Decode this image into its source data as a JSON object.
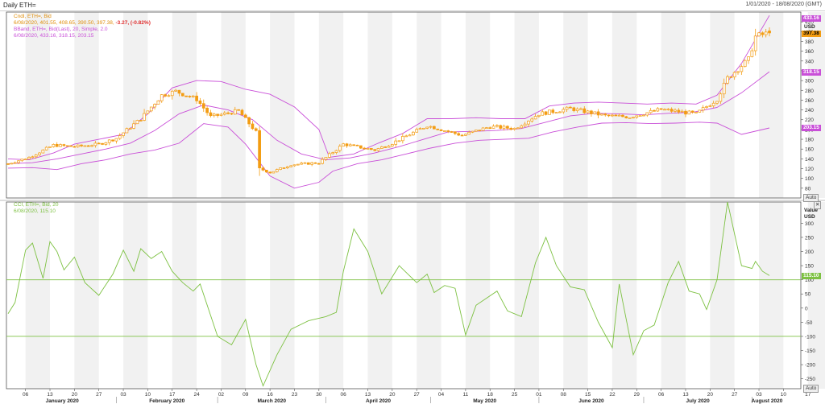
{
  "window": {
    "title": "Daily ETH=",
    "range": "1/01/2020 - 18/08/2020 (GMT)"
  },
  "legend_price": {
    "l1": "Cndl, ETH=, Bid",
    "l2a": "6/08/2020, 401.55, 408.65, 390.50, 397.38,",
    "l2b": " -3.27, (-0.82%)",
    "l3": "BBand, ETH=, Bid(Last), 20, Simple, 2.0",
    "l4": "6/08/2020, 433.16, 318.15, 203.15"
  },
  "legend_cci": {
    "l1": "CCI, ETH=, Bid, 20",
    "l2": "6/08/2020, 115.10"
  },
  "axis_price": {
    "unit1": "Price",
    "unit2": "USD",
    "button": "Auto",
    "ticks": [
      "80",
      "100",
      "120",
      "140",
      "160",
      "180",
      "200",
      "220",
      "240",
      "260",
      "280",
      "300",
      "320",
      "340",
      "360",
      "380",
      "400",
      "420"
    ]
  },
  "axis_cci": {
    "unit1": "Value",
    "unit2": "USD",
    "button": "Auto",
    "ticks": [
      "-250",
      "-200",
      "-150",
      "-100",
      "-50",
      "0",
      "50",
      "100",
      "150",
      "200",
      "250",
      "300"
    ]
  },
  "tags": {
    "upper": "433.16",
    "close": "397.38",
    "mid": "318.15",
    "lower": "203.15",
    "cci": "115.10"
  },
  "colors": {
    "candle": "#f39c12",
    "band": "#c94fd8",
    "cci": "#7dc142",
    "tag_close": "#f39c12",
    "tag_band": "#c94fd8",
    "tag_cci": "#7dc142"
  },
  "xaxis": {
    "days": [
      "06",
      "13",
      "20",
      "27",
      "03",
      "10",
      "17",
      "24",
      "02",
      "09",
      "16",
      "23",
      "30",
      "06",
      "13",
      "20",
      "27",
      "04",
      "11",
      "18",
      "25",
      "01",
      "08",
      "15",
      "22",
      "29",
      "06",
      "13",
      "20",
      "27",
      "03",
      "10",
      "17"
    ],
    "months": [
      "January 2020",
      "February 2020",
      "March 2020",
      "April 2020",
      "May 2020",
      "June 2020",
      "July 2020",
      "August 2020"
    ]
  },
  "chart_data": [
    {
      "type": "candlestick",
      "title": "Daily ETH=",
      "unit": "USD",
      "ylim": [
        60,
        440
      ],
      "x_start": "2020-01-01",
      "x_end": "2020-08-06",
      "close_anchors": [
        {
          "date": "2020-01-01",
          "value": 130
        },
        {
          "date": "2020-01-07",
          "value": 143
        },
        {
          "date": "2020-01-14",
          "value": 168
        },
        {
          "date": "2020-01-20",
          "value": 165
        },
        {
          "date": "2020-01-27",
          "value": 170
        },
        {
          "date": "2020-02-01",
          "value": 182
        },
        {
          "date": "2020-02-08",
          "value": 222
        },
        {
          "date": "2020-02-14",
          "value": 270
        },
        {
          "date": "2020-02-18",
          "value": 278
        },
        {
          "date": "2020-02-24",
          "value": 262
        },
        {
          "date": "2020-02-28",
          "value": 226
        },
        {
          "date": "2020-03-07",
          "value": 238
        },
        {
          "date": "2020-03-12",
          "value": 195
        },
        {
          "date": "2020-03-13",
          "value": 120
        },
        {
          "date": "2020-03-16",
          "value": 112
        },
        {
          "date": "2020-03-22",
          "value": 128
        },
        {
          "date": "2020-03-30",
          "value": 132
        },
        {
          "date": "2020-04-06",
          "value": 170
        },
        {
          "date": "2020-04-15",
          "value": 158
        },
        {
          "date": "2020-04-20",
          "value": 172
        },
        {
          "date": "2020-04-30",
          "value": 208
        },
        {
          "date": "2020-05-10",
          "value": 188
        },
        {
          "date": "2020-05-18",
          "value": 206
        },
        {
          "date": "2020-05-25",
          "value": 202
        },
        {
          "date": "2020-06-01",
          "value": 232
        },
        {
          "date": "2020-06-10",
          "value": 243
        },
        {
          "date": "2020-06-20",
          "value": 228
        },
        {
          "date": "2020-06-27",
          "value": 226
        },
        {
          "date": "2020-07-06",
          "value": 241
        },
        {
          "date": "2020-07-16",
          "value": 232
        },
        {
          "date": "2020-07-22",
          "value": 262
        },
        {
          "date": "2020-07-25",
          "value": 305
        },
        {
          "date": "2020-07-31",
          "value": 343
        },
        {
          "date": "2020-08-02",
          "value": 390
        },
        {
          "date": "2020-08-06",
          "value": 397.38
        }
      ],
      "last_bar": {
        "date": "2020-08-06",
        "open": 401.55,
        "high": 408.65,
        "low": 390.5,
        "close": 397.38,
        "change": -3.27,
        "change_pct": -0.82
      }
    },
    {
      "type": "line",
      "series": [
        {
          "name": "BBand upper",
          "points": [
            [
              "2020-01-01",
              140
            ],
            [
              "2020-01-07",
              138
            ],
            [
              "2020-01-14",
              152
            ],
            [
              "2020-01-20",
              170
            ],
            [
              "2020-01-27",
              180
            ],
            [
              "2020-02-03",
              190
            ],
            [
              "2020-02-10",
              232
            ],
            [
              "2020-02-17",
              285
            ],
            [
              "2020-02-24",
              300
            ],
            [
              "2020-03-02",
              298
            ],
            [
              "2020-03-09",
              282
            ],
            [
              "2020-03-16",
              272
            ],
            [
              "2020-03-23",
              246
            ],
            [
              "2020-03-30",
              200
            ],
            [
              "2020-04-02",
              143
            ],
            [
              "2020-04-09",
              150
            ],
            [
              "2020-04-16",
              172
            ],
            [
              "2020-04-23",
              192
            ],
            [
              "2020-04-30",
              222
            ],
            [
              "2020-05-07",
              222
            ],
            [
              "2020-05-14",
              224
            ],
            [
              "2020-05-21",
              222
            ],
            [
              "2020-05-28",
              222
            ],
            [
              "2020-06-04",
              248
            ],
            [
              "2020-06-11",
              254
            ],
            [
              "2020-06-18",
              256
            ],
            [
              "2020-06-25",
              254
            ],
            [
              "2020-07-02",
              252
            ],
            [
              "2020-07-09",
              254
            ],
            [
              "2020-07-16",
              252
            ],
            [
              "2020-07-22",
              270
            ],
            [
              "2020-07-29",
              335
            ],
            [
              "2020-08-06",
              433.16
            ]
          ]
        },
        {
          "name": "BBand middle",
          "points": [
            [
              "2020-01-01",
              130
            ],
            [
              "2020-01-08",
              132
            ],
            [
              "2020-01-15",
              140
            ],
            [
              "2020-01-22",
              150
            ],
            [
              "2020-01-29",
              160
            ],
            [
              "2020-02-05",
              172
            ],
            [
              "2020-02-12",
              198
            ],
            [
              "2020-02-19",
              232
            ],
            [
              "2020-02-26",
              250
            ],
            [
              "2020-03-04",
              240
            ],
            [
              "2020-03-11",
              220
            ],
            [
              "2020-03-18",
              178
            ],
            [
              "2020-03-25",
              150
            ],
            [
              "2020-04-01",
              138
            ],
            [
              "2020-04-08",
              142
            ],
            [
              "2020-04-15",
              152
            ],
            [
              "2020-04-22",
              165
            ],
            [
              "2020-04-29",
              180
            ],
            [
              "2020-05-06",
              195
            ],
            [
              "2020-05-13",
              196
            ],
            [
              "2020-05-20",
              198
            ],
            [
              "2020-05-27",
              202
            ],
            [
              "2020-06-03",
              215
            ],
            [
              "2020-06-10",
              228
            ],
            [
              "2020-06-17",
              233
            ],
            [
              "2020-06-24",
              232
            ],
            [
              "2020-07-01",
              230
            ],
            [
              "2020-07-08",
              233
            ],
            [
              "2020-07-15",
              235
            ],
            [
              "2020-07-22",
              245
            ],
            [
              "2020-07-29",
              275
            ],
            [
              "2020-08-06",
              318.15
            ]
          ]
        },
        {
          "name": "BBand lower",
          "points": [
            [
              "2020-01-01",
              121
            ],
            [
              "2020-01-08",
              122
            ],
            [
              "2020-01-15",
              118
            ],
            [
              "2020-01-22",
              130
            ],
            [
              "2020-01-29",
              138
            ],
            [
              "2020-02-05",
              150
            ],
            [
              "2020-02-12",
              158
            ],
            [
              "2020-02-19",
              172
            ],
            [
              "2020-02-26",
              212
            ],
            [
              "2020-03-04",
              205
            ],
            [
              "2020-03-09",
              170
            ],
            [
              "2020-03-16",
              105
            ],
            [
              "2020-03-23",
              80
            ],
            [
              "2020-03-30",
              92
            ],
            [
              "2020-04-03",
              115
            ],
            [
              "2020-04-10",
              130
            ],
            [
              "2020-04-17",
              138
            ],
            [
              "2020-04-24",
              150
            ],
            [
              "2020-05-01",
              162
            ],
            [
              "2020-05-08",
              172
            ],
            [
              "2020-05-15",
              178
            ],
            [
              "2020-05-22",
              180
            ],
            [
              "2020-05-29",
              182
            ],
            [
              "2020-06-05",
              195
            ],
            [
              "2020-06-12",
              205
            ],
            [
              "2020-06-19",
              213
            ],
            [
              "2020-06-26",
              214
            ],
            [
              "2020-07-03",
              212
            ],
            [
              "2020-07-10",
              213
            ],
            [
              "2020-07-17",
              215
            ],
            [
              "2020-07-22",
              213
            ],
            [
              "2020-07-29",
              190
            ],
            [
              "2020-08-06",
              203.15
            ]
          ]
        }
      ]
    },
    {
      "type": "line",
      "unit": "USD",
      "ylim": [
        -285,
        375
      ],
      "hlines": [
        100,
        -100
      ],
      "series": [
        {
          "name": "CCI",
          "points": [
            [
              "2020-01-01",
              -20
            ],
            [
              "2020-01-03",
              20
            ],
            [
              "2020-01-06",
              205
            ],
            [
              "2020-01-08",
              230
            ],
            [
              "2020-01-11",
              105
            ],
            [
              "2020-01-13",
              235
            ],
            [
              "2020-01-15",
              200
            ],
            [
              "2020-01-17",
              135
            ],
            [
              "2020-01-20",
              180
            ],
            [
              "2020-01-23",
              90
            ],
            [
              "2020-01-27",
              45
            ],
            [
              "2020-01-31",
              120
            ],
            [
              "2020-02-03",
              205
            ],
            [
              "2020-02-06",
              130
            ],
            [
              "2020-02-08",
              210
            ],
            [
              "2020-02-11",
              175
            ],
            [
              "2020-02-14",
              200
            ],
            [
              "2020-02-17",
              130
            ],
            [
              "2020-02-20",
              90
            ],
            [
              "2020-02-23",
              60
            ],
            [
              "2020-02-25",
              85
            ],
            [
              "2020-03-01",
              -100
            ],
            [
              "2020-03-05",
              -130
            ],
            [
              "2020-03-09",
              -40
            ],
            [
              "2020-03-12",
              -200
            ],
            [
              "2020-03-14",
              -275
            ],
            [
              "2020-03-18",
              -165
            ],
            [
              "2020-03-22",
              -75
            ],
            [
              "2020-03-27",
              -45
            ],
            [
              "2020-04-01",
              -30
            ],
            [
              "2020-04-04",
              -15
            ],
            [
              "2020-04-06",
              130
            ],
            [
              "2020-04-09",
              280
            ],
            [
              "2020-04-13",
              200
            ],
            [
              "2020-04-17",
              50
            ],
            [
              "2020-04-22",
              150
            ],
            [
              "2020-04-27",
              90
            ],
            [
              "2020-04-30",
              120
            ],
            [
              "2020-05-02",
              55
            ],
            [
              "2020-05-05",
              80
            ],
            [
              "2020-05-08",
              70
            ],
            [
              "2020-05-11",
              -95
            ],
            [
              "2020-05-14",
              10
            ],
            [
              "2020-05-17",
              35
            ],
            [
              "2020-05-20",
              60
            ],
            [
              "2020-05-23",
              -10
            ],
            [
              "2020-05-27",
              -30
            ],
            [
              "2020-05-31",
              160
            ],
            [
              "2020-06-03",
              250
            ],
            [
              "2020-06-06",
              150
            ],
            [
              "2020-06-10",
              75
            ],
            [
              "2020-06-14",
              65
            ],
            [
              "2020-06-18",
              -50
            ],
            [
              "2020-06-22",
              -140
            ],
            [
              "2020-06-24",
              85
            ],
            [
              "2020-06-28",
              -165
            ],
            [
              "2020-07-01",
              -80
            ],
            [
              "2020-07-04",
              -60
            ],
            [
              "2020-07-08",
              90
            ],
            [
              "2020-07-11",
              165
            ],
            [
              "2020-07-14",
              60
            ],
            [
              "2020-07-17",
              50
            ],
            [
              "2020-07-19",
              -5
            ],
            [
              "2020-07-22",
              100
            ],
            [
              "2020-07-25",
              375
            ],
            [
              "2020-07-29",
              150
            ],
            [
              "2020-08-01",
              140
            ],
            [
              "2020-08-02",
              165
            ],
            [
              "2020-08-04",
              130
            ],
            [
              "2020-08-06",
              115.1
            ]
          ]
        }
      ]
    }
  ]
}
